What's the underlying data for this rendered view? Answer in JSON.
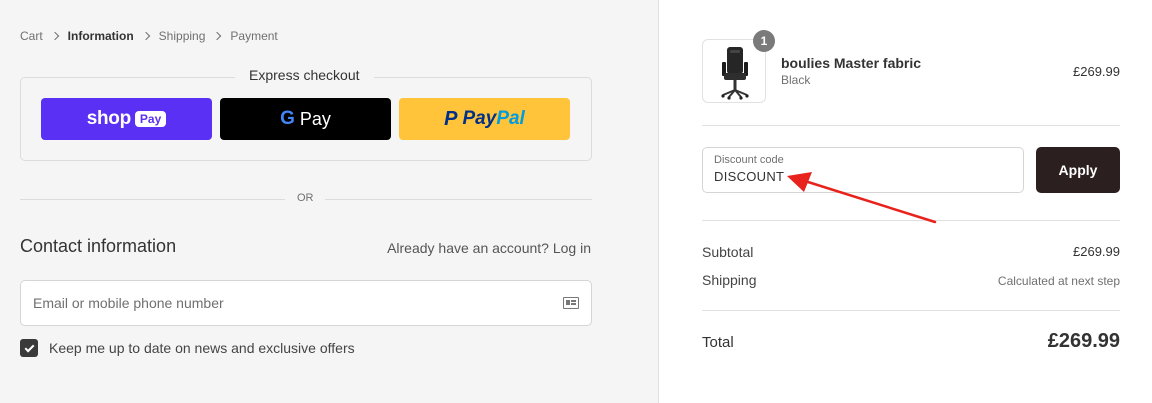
{
  "breadcrumb": {
    "items": [
      "Cart",
      "Information",
      "Shipping",
      "Payment"
    ],
    "active_index": 1
  },
  "express": {
    "title": "Express checkout",
    "shop_label": "shop",
    "shop_pill": "Pay",
    "gpay_g": "G",
    "gpay_label": "Pay",
    "paypal_pay": "Pay",
    "paypal_pal": "Pal",
    "paypal_mark": "P"
  },
  "divider": {
    "label": "OR"
  },
  "contact": {
    "title": "Contact information",
    "account_prompt": "Already have an account?",
    "login_label": "Log in",
    "email_placeholder": "Email or mobile phone number",
    "newsletter_label": "Keep me up to date on news and exclusive offers",
    "newsletter_checked": true
  },
  "cart": {
    "quantity": "1",
    "product_name": "boulies Master fabric",
    "product_variant": "Black",
    "product_price": "£269.99"
  },
  "discount": {
    "label": "Discount code",
    "value": "DISCOUNT",
    "apply_label": "Apply"
  },
  "summary": {
    "subtotal_label": "Subtotal",
    "subtotal_value": "£269.99",
    "shipping_label": "Shipping",
    "shipping_value": "Calculated at next step",
    "total_label": "Total",
    "total_value": "£269.99"
  },
  "colors": {
    "shop_pay": "#5a31f4",
    "gpay": "#000000",
    "paypal": "#ffc439",
    "apply": "#2b1f1f",
    "annotation_arrow": "#e8231e"
  }
}
